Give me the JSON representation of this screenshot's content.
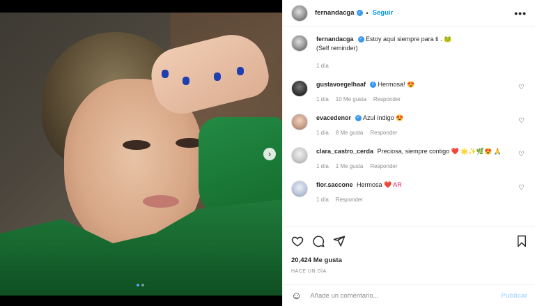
{
  "post": {
    "username": "fernandacga",
    "follow_label": "Seguir",
    "separator": "•",
    "more_label": "•••",
    "caption": "Estoy aquí siempre para ti . 🐸",
    "caption_line2": "(Self reminder)",
    "caption_time": "1 día"
  },
  "comments": [
    {
      "user": "gustavoegelhaaf",
      "verified": true,
      "text": "Hermosa!",
      "emoji": "😍",
      "time": "1 día",
      "likes": "10 Me gusta",
      "reply": "Responder"
    },
    {
      "user": "evacedenor",
      "verified": true,
      "text": "Azul índigo",
      "emoji": "😍",
      "time": "1 día",
      "likes": "8 Me gusta",
      "reply": "Responder"
    },
    {
      "user": "clara_castro_cerda",
      "verified": false,
      "text": "Preciosa, siempre contigo",
      "emoji": "❤️ 🌟✨🌿😍 🙏",
      "time": "1 día",
      "likes": "1 Me gusta",
      "reply": "Responder"
    },
    {
      "user": "flor.saccone",
      "verified": false,
      "text": "Hermosa",
      "emoji": "❤️ AR",
      "time": "1 día",
      "likes": "",
      "reply": "Responder"
    }
  ],
  "stats": {
    "likes": "20,424 Me gusta",
    "posted": "HACE UN DÍA"
  },
  "composer": {
    "placeholder": "Añade un comentario...",
    "publish_label": "Publicar"
  },
  "carousel": {
    "dots": 2,
    "active": 0,
    "next_icon": "chevron-right-icon"
  },
  "colors": {
    "accent": "#0095f6",
    "verified": "#3897f0",
    "muted": "#8e8e8e"
  }
}
